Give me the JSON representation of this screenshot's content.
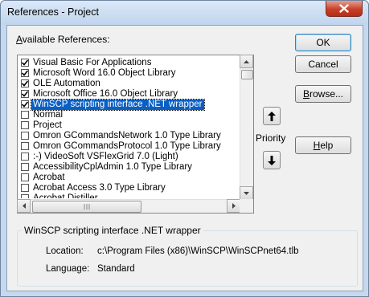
{
  "window": {
    "title": "References - Project"
  },
  "list": {
    "label_prefix": "A",
    "label_rest": "vailable References:",
    "items": [
      {
        "label": "Visual Basic For Applications",
        "checked": true,
        "selected": false
      },
      {
        "label": "Microsoft Word 16.0 Object Library",
        "checked": true,
        "selected": false
      },
      {
        "label": "OLE Automation",
        "checked": true,
        "selected": false
      },
      {
        "label": "Microsoft Office 16.0 Object Library",
        "checked": true,
        "selected": false
      },
      {
        "label": "WinSCP scripting interface .NET wrapper",
        "checked": true,
        "selected": true
      },
      {
        "label": "Normal",
        "checked": false,
        "selected": false
      },
      {
        "label": "Project",
        "checked": false,
        "selected": false
      },
      {
        "label": " Omron GCommandsNetwork 1.0 Type Library",
        "checked": false,
        "selected": false
      },
      {
        "label": " Omron GCommandsProtocol 1.0 Type Library",
        "checked": false,
        "selected": false
      },
      {
        "label": ":-) VideoSoft VSFlexGrid 7.0 (Light)",
        "checked": false,
        "selected": false
      },
      {
        "label": "AccessibilityCplAdmin 1.0 Type Library",
        "checked": false,
        "selected": false
      },
      {
        "label": "Acrobat",
        "checked": false,
        "selected": false
      },
      {
        "label": "Acrobat Access 3.0 Type Library",
        "checked": false,
        "selected": false
      },
      {
        "label": "Acrobat Distiller",
        "checked": false,
        "selected": false
      }
    ]
  },
  "buttons": {
    "ok": "OK",
    "cancel": "Cancel",
    "browse_prefix": "B",
    "browse_rest": "rowse...",
    "help_prefix": "H",
    "help_rest": "elp"
  },
  "priority_label": "Priority",
  "details": {
    "title": "WinSCP scripting interface .NET wrapper",
    "location_label": "Location:",
    "location_value": "c:\\Program Files (x86)\\WinSCP\\WinSCPnet64.tlb",
    "language_label": "Language:",
    "language_value": "Standard"
  },
  "icons": {
    "close": "close-icon",
    "up": "arrow-up-icon",
    "down": "arrow-down-icon",
    "check": "checkmark-icon"
  },
  "colors": {
    "selection": "#0a5fc4",
    "close_button": "#c7412a"
  }
}
